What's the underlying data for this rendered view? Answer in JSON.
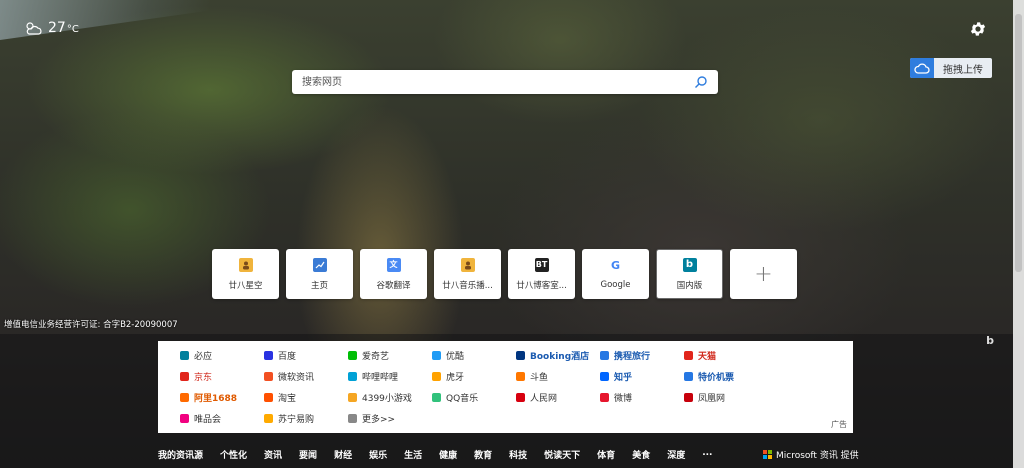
{
  "weather": {
    "temp": "27",
    "unit": "°C",
    "icon": "partly-cloudy-icon"
  },
  "upload": {
    "label": "拖拽上传",
    "icon": "cloud-upload-icon"
  },
  "search": {
    "placeholder": "搜索网页",
    "icon": "search-icon"
  },
  "tiles": [
    {
      "label": "廿八星空",
      "icon_color": "#f0b43c",
      "glyph": ""
    },
    {
      "label": "主页",
      "icon_color": "#3a7bd5",
      "glyph": ""
    },
    {
      "label": "谷歌翻译",
      "icon_color": "#4a8af4",
      "glyph": ""
    },
    {
      "label": "廿八音乐播...",
      "icon_color": "#f0b43c",
      "glyph": ""
    },
    {
      "label": "廿八博客室...",
      "icon_color": "#222222",
      "glyph": "BT"
    },
    {
      "label": "Google",
      "icon_color": "#ffffff",
      "glyph": "G"
    },
    {
      "label": "国内版",
      "icon_color": "#00809d",
      "glyph": "b"
    }
  ],
  "license": "增值电信业务经营许可证: 合字B2-20090007",
  "links": [
    [
      {
        "label": "必应",
        "color": "#00809d",
        "bold": false
      },
      {
        "label": "百度",
        "color": "#2932e1",
        "bold": false
      },
      {
        "label": "爱奇艺",
        "color": "#00be06",
        "bold": false
      },
      {
        "label": "优酷",
        "color": "#1f9bf5",
        "bold": false
      },
      {
        "label": "Booking酒店",
        "color": "#003580",
        "bold": true,
        "text_color": "#1a5ab0"
      },
      {
        "label": "携程旅行",
        "color": "#2577e3",
        "bold": true,
        "text_color": "#1a5ab0"
      },
      {
        "label": "天猫",
        "color": "#e1251b",
        "bold": true,
        "text_color": "#d0281b"
      }
    ],
    [
      {
        "label": "京东",
        "color": "#e1251b",
        "bold": false,
        "text_color": "#d0281b"
      },
      {
        "label": "微软资讯",
        "color": "#f25022",
        "bold": false
      },
      {
        "label": "哔哩哔哩",
        "color": "#00a1d6",
        "bold": false
      },
      {
        "label": "虎牙",
        "color": "#ffa200",
        "bold": false
      },
      {
        "label": "斗鱼",
        "color": "#ff7700",
        "bold": false
      },
      {
        "label": "知乎",
        "color": "#0066ff",
        "bold": true,
        "text_color": "#1a5ab0"
      },
      {
        "label": "特价机票",
        "color": "#2577e3",
        "bold": true,
        "text_color": "#1a5ab0"
      }
    ],
    [
      {
        "label": "阿里1688",
        "color": "#ff6a00",
        "bold": true,
        "text_color": "#e05a00"
      },
      {
        "label": "淘宝",
        "color": "#ff5000",
        "bold": false
      },
      {
        "label": "4399小游戏",
        "color": "#f5a623",
        "bold": false
      },
      {
        "label": "QQ音乐",
        "color": "#31c27c",
        "bold": false
      },
      {
        "label": "人民网",
        "color": "#d7000f",
        "bold": false
      },
      {
        "label": "微博",
        "color": "#e6162d",
        "bold": false
      },
      {
        "label": "凤凰网",
        "color": "#c7000b",
        "bold": false
      }
    ],
    [
      {
        "label": "唯品会",
        "color": "#f10180",
        "bold": false
      },
      {
        "label": "苏宁易购",
        "color": "#ffaa00",
        "bold": false
      },
      {
        "label": "更多>>",
        "color": "#888888",
        "bold": false
      }
    ]
  ],
  "ad_label": "广告",
  "nav": [
    "我的资讯源",
    "个性化",
    "资讯",
    "要闻",
    "财经",
    "娱乐",
    "生活",
    "健康",
    "教育",
    "科技",
    "悦读天下",
    "体育",
    "美食",
    "深度",
    "..."
  ],
  "provider": "Microsoft 资讯 提供"
}
